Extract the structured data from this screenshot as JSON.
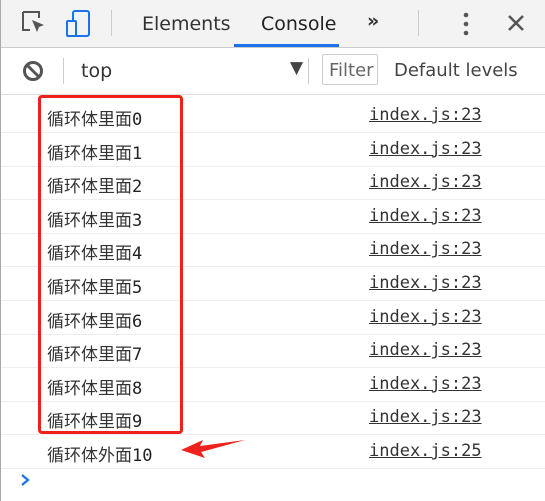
{
  "toolbar": {
    "tabs": [
      {
        "label": "Elements"
      },
      {
        "label": "Console",
        "active": true
      }
    ],
    "more_label": "»",
    "icons": [
      "inspect-icon",
      "device-toggle-icon",
      "more-vert-icon",
      "close-icon"
    ]
  },
  "console_bar": {
    "context": "top",
    "filter_placeholder": "Filter",
    "levels": "Default levels"
  },
  "accent": "#1a73e8",
  "highlight": "#f0201c",
  "logs": [
    {
      "text": "循环体里面",
      "value": "0",
      "source": "index.js:23"
    },
    {
      "text": "循环体里面",
      "value": "1",
      "source": "index.js:23"
    },
    {
      "text": "循环体里面",
      "value": "2",
      "source": "index.js:23"
    },
    {
      "text": "循环体里面",
      "value": "3",
      "source": "index.js:23"
    },
    {
      "text": "循环体里面",
      "value": "4",
      "source": "index.js:23"
    },
    {
      "text": "循环体里面",
      "value": "5",
      "source": "index.js:23"
    },
    {
      "text": "循环体里面",
      "value": "6",
      "source": "index.js:23"
    },
    {
      "text": "循环体里面",
      "value": "7",
      "source": "index.js:23"
    },
    {
      "text": "循环体里面",
      "value": "8",
      "source": "index.js:23"
    },
    {
      "text": "循环体里面",
      "value": "9",
      "source": "index.js:23"
    },
    {
      "text": "循环体外面",
      "value": "10",
      "source": "index.js:25"
    }
  ]
}
